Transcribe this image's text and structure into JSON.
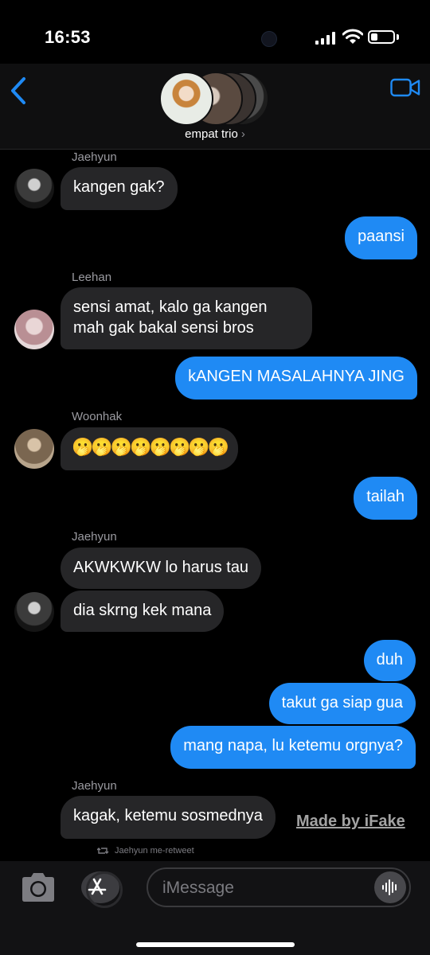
{
  "status_bar": {
    "time": "16:53",
    "battery_level": 0.3
  },
  "header": {
    "group_name": "empat trio",
    "chevron": "›",
    "back_icon": "chevron-left-icon",
    "video_icon": "video-camera-icon"
  },
  "messages": [
    {
      "sender": "Jaehyun",
      "text": "kangen gak?",
      "dir": "in"
    },
    {
      "text": "paansi",
      "dir": "out"
    },
    {
      "sender": "Leehan",
      "text": "sensi amat, kalo ga kangen mah gak bakal sensi bros",
      "dir": "in"
    },
    {
      "text": "kANGEN MASALAHNYA JING",
      "dir": "out"
    },
    {
      "sender": "Woonhak",
      "text": "🫢🫢🫢🫢🫢🫢🫢🫢",
      "dir": "in"
    },
    {
      "text": "tailah",
      "dir": "out"
    },
    {
      "sender": "Jaehyun",
      "text": "AKWKWKW lo harus tau",
      "dir": "in"
    },
    {
      "text": "dia skrng kek mana",
      "dir": "in"
    },
    {
      "text": "duh",
      "dir": "out"
    },
    {
      "text": "takut ga siap gua",
      "dir": "out"
    },
    {
      "text": "mang napa, lu ketemu orgnya?",
      "dir": "out"
    },
    {
      "sender": "Jaehyun",
      "text": "kagak, ketemu sosmednya",
      "dir": "in"
    }
  ],
  "watermark": "Made by iFake",
  "retweet_note": "Jaehyun me-retweet",
  "input_bar": {
    "placeholder": "iMessage"
  },
  "colors": {
    "outgoing_bubble": "#1f8af4",
    "incoming_bubble": "#262628",
    "background": "#000000"
  }
}
